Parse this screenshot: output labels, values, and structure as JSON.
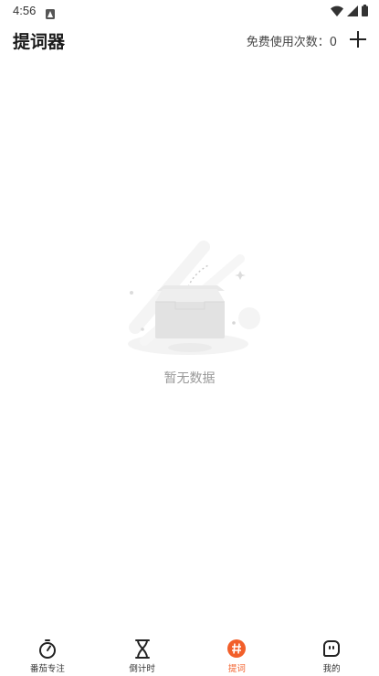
{
  "status_bar": {
    "time": "4:56"
  },
  "header": {
    "title": "提词器",
    "free_uses_label": "免费使用次数：",
    "free_uses_count": "0"
  },
  "empty_state": {
    "message": "暂无数据"
  },
  "bottom_nav": {
    "accent_color": "#f25f2a",
    "items": [
      {
        "label": "番茄专注",
        "icon": "stopwatch-icon",
        "active": false
      },
      {
        "label": "倒计时",
        "icon": "hourglass-icon",
        "active": false
      },
      {
        "label": "提词",
        "icon": "hash-icon",
        "active": true
      },
      {
        "label": "我的",
        "icon": "profile-face-icon",
        "active": false
      }
    ]
  }
}
